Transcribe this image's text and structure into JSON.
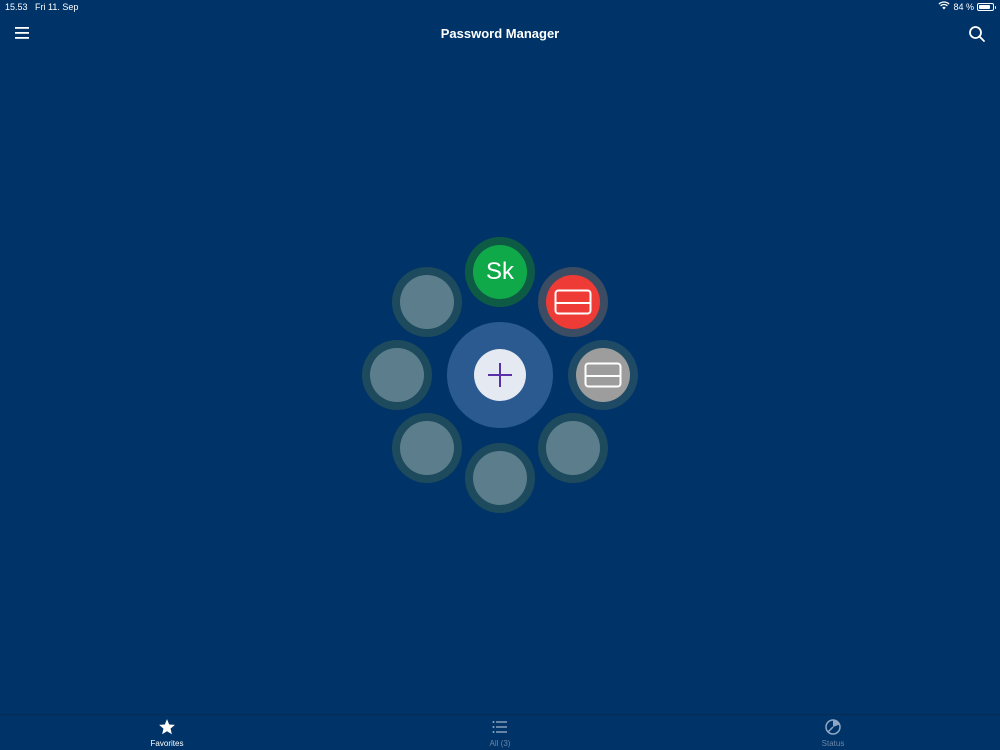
{
  "status_bar": {
    "time": "15.53",
    "date": "Fri 11. Sep",
    "battery_percent": "84 %",
    "battery_level": 0.84
  },
  "header": {
    "title": "Password Manager",
    "menu_icon": "hamburger-menu-icon",
    "search_icon": "search-icon"
  },
  "favorites_wheel": {
    "center_button_icon": "plus-icon",
    "slots": [
      {
        "position": "top",
        "kind": "initials",
        "text": "Sk",
        "color": "#10a94a"
      },
      {
        "position": "top-right",
        "kind": "card",
        "icon": "credit-card-icon",
        "color": "#ee3b36"
      },
      {
        "position": "right",
        "kind": "card",
        "icon": "credit-card-icon",
        "color": "#9d9d9d"
      },
      {
        "position": "bottom-right",
        "kind": "empty"
      },
      {
        "position": "bottom",
        "kind": "empty"
      },
      {
        "position": "bottom-left",
        "kind": "empty"
      },
      {
        "position": "left",
        "kind": "empty"
      },
      {
        "position": "top-left",
        "kind": "empty"
      }
    ]
  },
  "tabs": [
    {
      "label": "Favorites",
      "icon": "star-icon",
      "active": true
    },
    {
      "label": "All (3)",
      "icon": "list-icon",
      "active": false
    },
    {
      "label": "Status",
      "icon": "status-gauge-icon",
      "active": false
    }
  ]
}
